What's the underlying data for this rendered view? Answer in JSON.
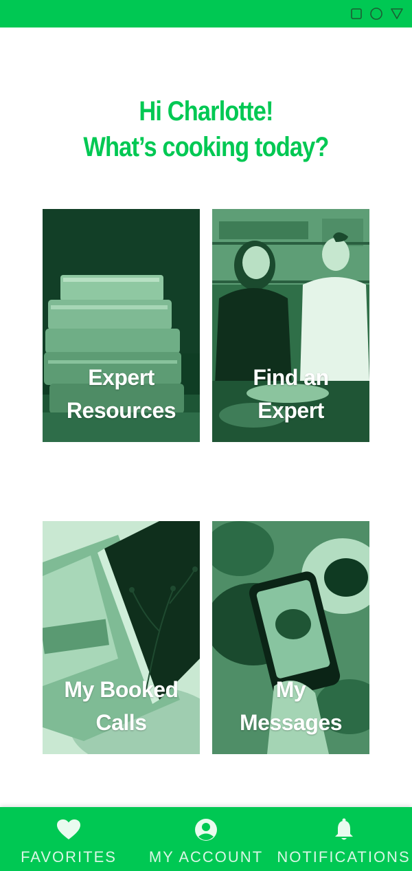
{
  "colors": {
    "accent": "#00c853",
    "tile_dark": "#0d3a22",
    "tile_mid": "#2f7a4c",
    "tile_light": "#a9d9b8",
    "text_on_accent": "#ffffff"
  },
  "status_bar": {
    "icons": [
      "square-icon",
      "circle-icon",
      "triangle-down-icon"
    ]
  },
  "greeting": {
    "line1": "Hi Charlotte!",
    "line2": "What’s cooking today?"
  },
  "tiles": [
    {
      "line1": "Expert",
      "line2": "Resources",
      "image": "stacked-books-photo"
    },
    {
      "line1": "Find an",
      "line2": "Expert",
      "image": "couple-cooking-photo"
    },
    {
      "line1": "My Booked",
      "line2": "Calls",
      "image": "notebook-and-plant-photo"
    },
    {
      "line1": "My",
      "line2": "Messages",
      "image": "phone-photographing-food-photo"
    }
  ],
  "bottom_nav": {
    "items": [
      {
        "label": "FAVORITES",
        "icon": "heart-icon"
      },
      {
        "label": "MY ACCOUNT",
        "icon": "account-circle-icon"
      },
      {
        "label": "NOTIFICATIONS",
        "icon": "bell-icon"
      }
    ]
  }
}
